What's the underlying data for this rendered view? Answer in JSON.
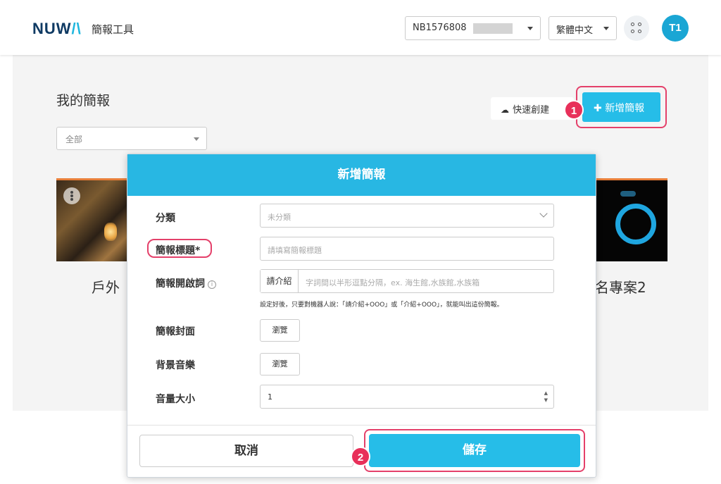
{
  "header": {
    "logo_main": "NUW",
    "logo_accent": "/\\",
    "app_name": "簡報工具",
    "device_id": "NB1576808",
    "language": "繁體中文",
    "user_initials": "T1"
  },
  "page": {
    "title": "我的簡報",
    "filter_value": "全部",
    "quick_create_label": "快速創建",
    "new_presentation_label": "新增簡報"
  },
  "cards": [
    {
      "caption": "戶外"
    },
    {
      "caption": "名專案2"
    }
  ],
  "annotations": {
    "step1": "1",
    "step2": "2"
  },
  "modal": {
    "title": "新增簡報",
    "fields": {
      "category": {
        "label": "分類",
        "value": "未分類"
      },
      "title": {
        "label": "簡報標題*",
        "placeholder": "請填寫簡報標題"
      },
      "opening": {
        "label": "簡報開啟詞",
        "prefix": "請介紹",
        "placeholder": "字詞間以半形逗點分隔，ex. 海生館,水族館,水族箱",
        "hint": "設定好後，只要對機器人說：「請介紹+OOO」或「介紹+OOO」，就能叫出這份簡報。"
      },
      "cover": {
        "label": "簡報封面",
        "button": "瀏覽"
      },
      "music": {
        "label": "背景音樂",
        "button": "瀏覽"
      },
      "volume": {
        "label": "音量大小",
        "value": "1"
      }
    },
    "cancel_label": "取消",
    "save_label": "儲存"
  }
}
